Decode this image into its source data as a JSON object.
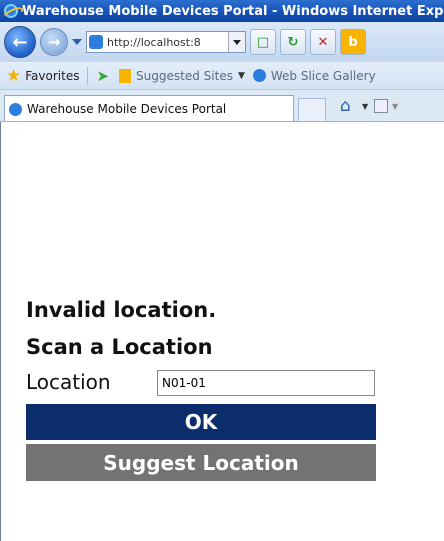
{
  "window": {
    "title": "Warehouse Mobile Devices Portal - Windows Internet Explorer"
  },
  "navigation": {
    "back_icon": "back-arrow-icon",
    "forward_icon": "forward-arrow-icon",
    "address": "http://localhost:8",
    "refresh_icon": "refresh-icon",
    "stop_icon": "stop-icon"
  },
  "favorites_bar": {
    "favorites_label": "Favorites",
    "suggested_sites_label": "Suggested Sites",
    "web_slice_label": "Web Slice Gallery"
  },
  "tabs": [
    {
      "label": "Warehouse Mobile Devices Portal"
    }
  ],
  "page": {
    "error_message": "Invalid location.",
    "prompt": "Scan a Location",
    "location_label": "Location",
    "location_value": "N01-01",
    "ok_button": "OK",
    "suggest_button": "Suggest Location"
  },
  "colors": {
    "ok_button_bg": "#0c2d6b",
    "suggest_button_bg": "#737373"
  }
}
